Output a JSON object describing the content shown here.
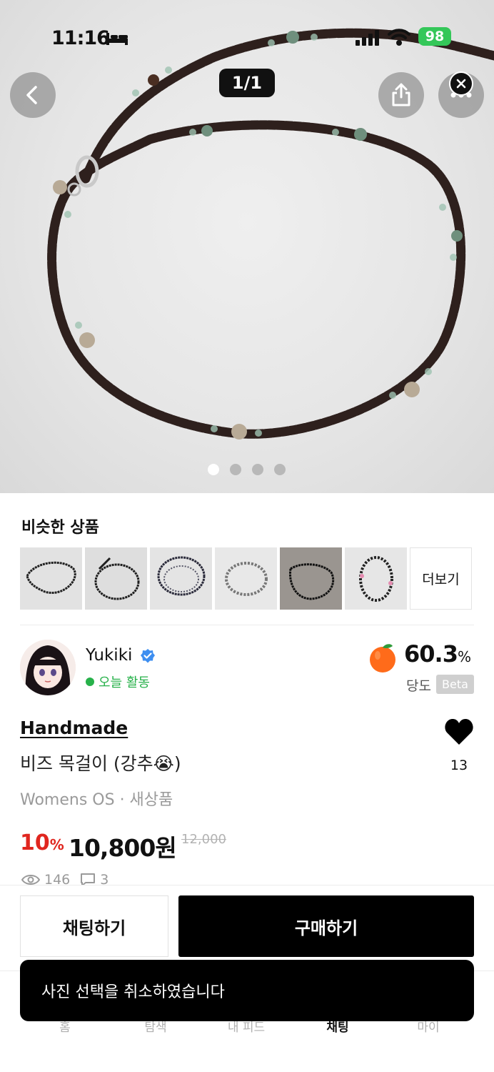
{
  "status_bar": {
    "time": "11:16",
    "battery": "98"
  },
  "gallery": {
    "counter": "1/1",
    "dot_count": 4,
    "active_dot": 0
  },
  "similar": {
    "title": "비슷한 상품",
    "more_label": "더보기",
    "thumb_count": 6
  },
  "seller": {
    "name": "Yukiki",
    "activity": "오늘 활동",
    "score": "60.3",
    "score_unit": "%",
    "score_label": "당도",
    "score_badge": "Beta"
  },
  "product": {
    "brand": "Handmade",
    "title": "비즈 목걸이 (강추😭)",
    "meta": "Womens OS · 새상품",
    "discount": "10",
    "discount_unit": "%",
    "price": "10,800원",
    "original_price": "12,000",
    "likes": "13",
    "views": "146",
    "comments": "3"
  },
  "actions": {
    "chat": "채팅하기",
    "buy": "구매하기"
  },
  "tabs": [
    {
      "label": "홈",
      "icon": "home-icon"
    },
    {
      "label": "탐색",
      "icon": "search-icon"
    },
    {
      "label": "내 피드",
      "icon": "plus-icon"
    },
    {
      "label": "채팅",
      "icon": "chat-icon"
    },
    {
      "label": "마이",
      "icon": "profile-icon"
    }
  ],
  "toast": {
    "message": "사진 선택을 취소하였습니다"
  },
  "colors": {
    "accent_red": "#e0261f",
    "active_green": "#27b14a",
    "verified_blue": "#3d8ef0",
    "peach": "#ff6b1a"
  }
}
